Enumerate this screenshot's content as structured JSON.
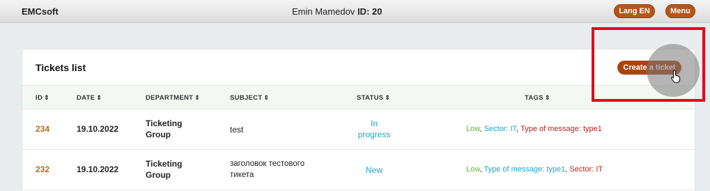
{
  "header": {
    "brand": "EMCsoft",
    "user_name": "Emin Mamedov",
    "user_id_label": "ID: 20",
    "lang_button": "Lang EN",
    "menu_button": "Menu"
  },
  "card": {
    "title": "Tickets list",
    "create_button": "Create a ticket"
  },
  "table": {
    "columns": [
      "ID",
      "DATE",
      "DEPARTMENT",
      "SUBJECT",
      "STATUS",
      "TAGS"
    ],
    "sort_glyph": "⇕",
    "rows": [
      {
        "id": "234",
        "date": "19.10.2022",
        "department_line1": "Ticketing",
        "department_line2": "Group",
        "subject_line1": "test",
        "subject_line2": "",
        "status_line1": "In",
        "status_line2": "progress",
        "tags": [
          {
            "text": "Low",
            "color": "green"
          },
          {
            "text": "Sector: IT",
            "color": "blue"
          },
          {
            "text": "Type of message: type1",
            "color": "red"
          }
        ]
      },
      {
        "id": "232",
        "date": "19.10.2022",
        "department_line1": "Ticketing",
        "department_line2": "Group",
        "subject_line1": "заголовок тестового",
        "subject_line2": "тикета",
        "status_line1": "New",
        "status_line2": "",
        "tags": [
          {
            "text": "Low",
            "color": "green"
          },
          {
            "text": "Type of message: type1",
            "color": "blue"
          },
          {
            "text": "Sector: IT",
            "color": "red"
          }
        ]
      }
    ]
  },
  "colors": {
    "accent": "#b4561a",
    "id_color": "#b86a13",
    "status_color": "#1aa7c9",
    "highlight": "#e0091f"
  },
  "icons": {
    "cursor": "hand-pointer-icon",
    "sort": "sort-icon"
  }
}
